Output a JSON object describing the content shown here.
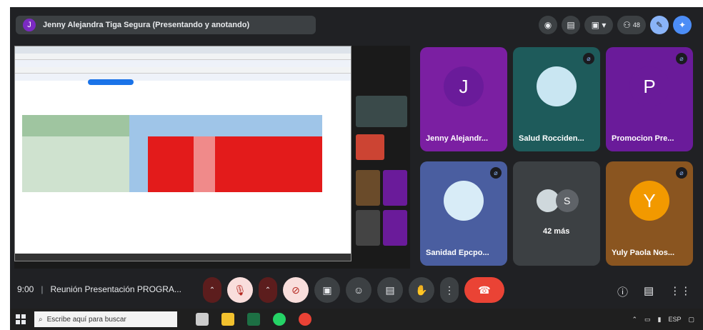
{
  "presenter": {
    "initial": "J",
    "label": "Jenny Alejandra Tiga Segura (Presentando y anotando)"
  },
  "top_controls": {
    "participant_count": "48"
  },
  "participants": [
    {
      "name": "Jenny Alejandr...",
      "avatar_text": "J",
      "color": "#7b1fa2"
    },
    {
      "name": "Salud Rocciden...",
      "avatar_text": "",
      "color": "#1e5b5b"
    },
    {
      "name": "Promocion Pre...",
      "avatar_text": "P",
      "color": "#6a1b9a"
    },
    {
      "name": "Sanidad Epcpo...",
      "avatar_text": "",
      "color": "#4a5ea0"
    },
    {
      "name": "42 más",
      "avatar_text": "S",
      "color": "#3c4043"
    },
    {
      "name": "Yuly Paola Nos...",
      "avatar_text": "Y",
      "color": "#8a5520"
    }
  ],
  "meeting": {
    "time": "9:00",
    "title": "Reunión Presentación PROGRA..."
  },
  "taskbar": {
    "search_placeholder": "Escribe aquí para buscar",
    "lang": "ESP"
  }
}
